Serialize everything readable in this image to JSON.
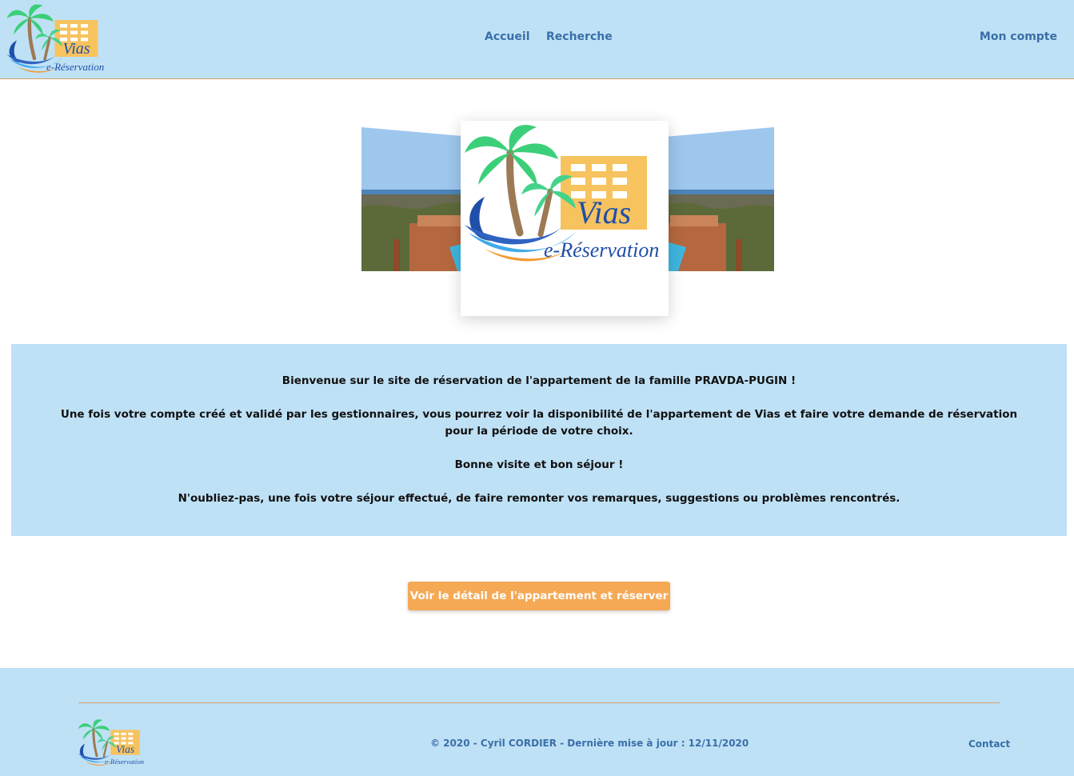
{
  "colors": {
    "header_bg": "#bfe1f6",
    "accent_orange": "#f5a955",
    "divider": "#d9a066",
    "link_blue": "#3a6fa8"
  },
  "brand": {
    "logo_icon": "vias-palm-tree-building-logo-icon",
    "logo_word": "Vias",
    "logo_sub": "e-Réservation"
  },
  "nav": {
    "home": "Accueil",
    "search": "Recherche",
    "account": "Mon compte"
  },
  "carousel": {
    "slides": [
      "apartment-terrace-pool-photo",
      "vias-logo",
      "apartment-terrace-pool-photo"
    ]
  },
  "welcome": {
    "line1": "Bienvenue sur le site de réservation de l'appartement de la famille PRAVDA-PUGIN !",
    "line2": "Une fois votre compte créé et validé par les gestionnaires, vous pourrez voir la disponibilité de l'appartement de Vias et faire votre demande de réservation pour la période de votre choix.",
    "line3": "Bonne visite et bon séjour !",
    "line4": "N'oubliez-pas, une fois votre séjour effectué, de faire remonter vos remarques, suggestions ou problèmes rencontrés."
  },
  "cta": {
    "label": "Voir le détail de l'appartement et réserver"
  },
  "footer": {
    "copyright": "© 2020 - Cyril CORDIER - Dernière mise à jour : 12/11/2020",
    "contact": "Contact"
  }
}
